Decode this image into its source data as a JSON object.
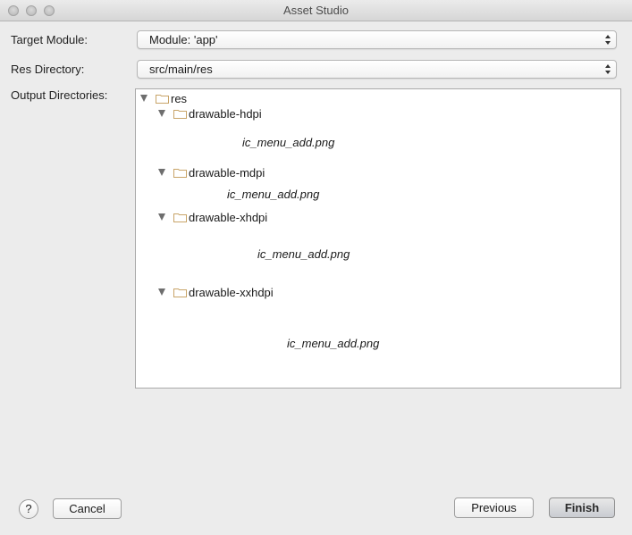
{
  "window": {
    "title": "Asset Studio"
  },
  "form": {
    "target_module_label": "Target Module:",
    "target_module_value": "Module: 'app'",
    "res_directory_label": "Res Directory:",
    "res_directory_value": "src/main/res",
    "output_directories_label": "Output Directories:"
  },
  "tree": {
    "root": "res",
    "folders": [
      {
        "name": "drawable-hdpi",
        "file": "ic_menu_add.png"
      },
      {
        "name": "drawable-mdpi",
        "file": "ic_menu_add.png"
      },
      {
        "name": "drawable-xhdpi",
        "file": "ic_menu_add.png"
      },
      {
        "name": "drawable-xxhdpi",
        "file": "ic_menu_add.png"
      }
    ]
  },
  "buttons": {
    "help": "?",
    "cancel": "Cancel",
    "previous": "Previous",
    "finish": "Finish"
  },
  "colors": {
    "folder_icon": "#c8a468",
    "window_bg": "#ececec"
  }
}
